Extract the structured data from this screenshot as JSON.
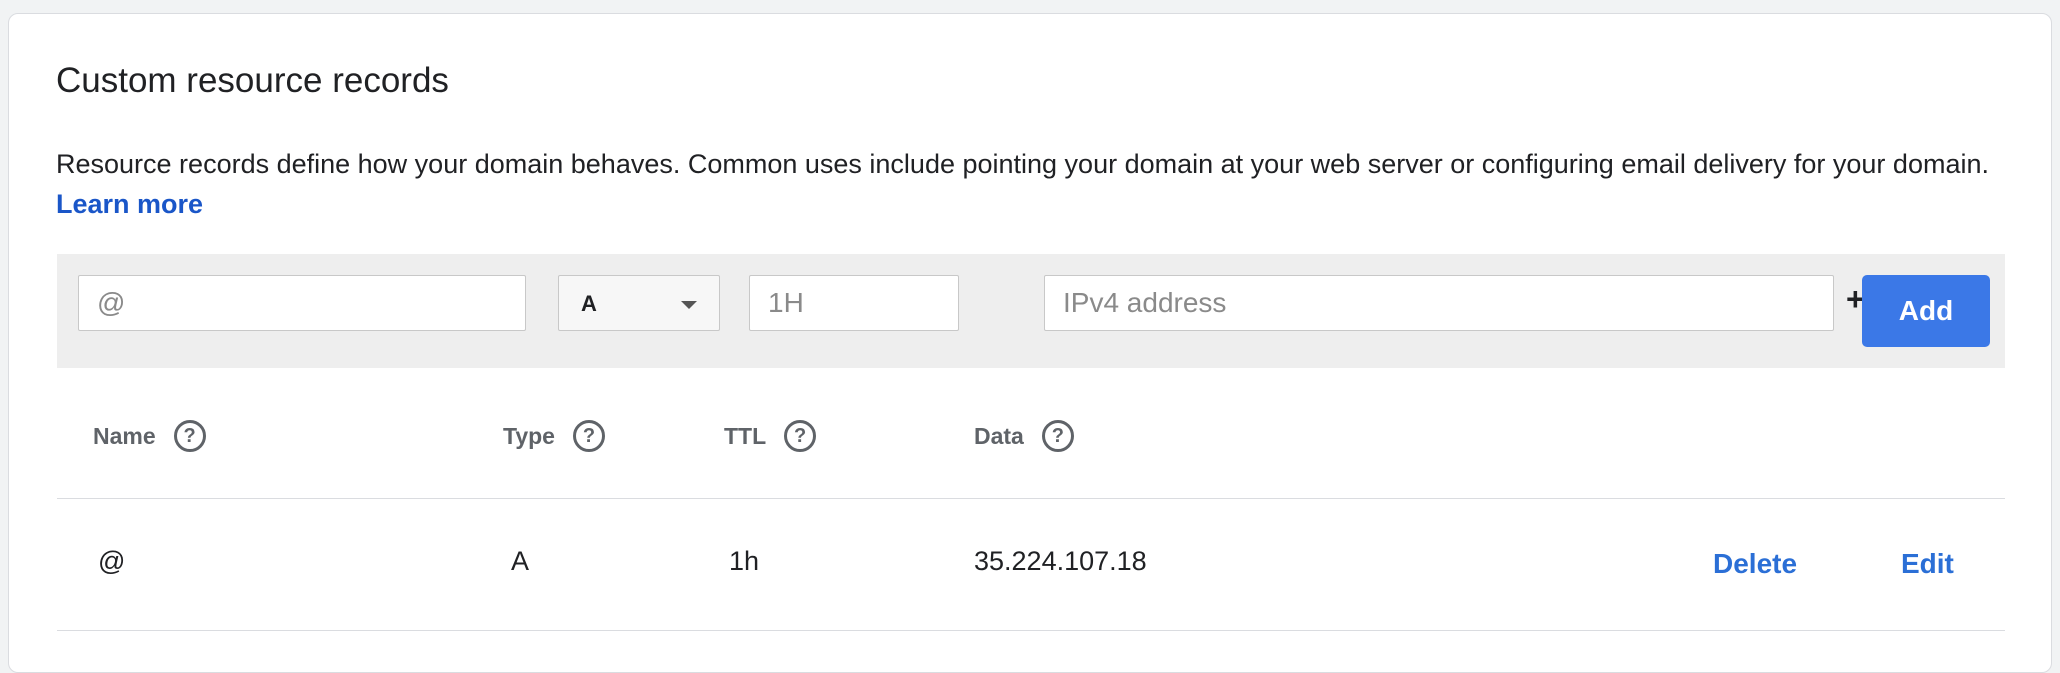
{
  "card": {
    "title": "Custom resource records",
    "description": "Resource records define how your domain behaves. Common uses include pointing your domain at your web server or configuring email delivery for your domain.",
    "learn_more": "Learn more"
  },
  "add_record": {
    "name_placeholder": "@",
    "type_value": "A",
    "ttl_placeholder": "1H",
    "data_placeholder": "IPv4 address",
    "plus_label": "+",
    "add_label": "Add"
  },
  "table": {
    "columns": [
      {
        "label": "Name",
        "help": "?"
      },
      {
        "label": "Type",
        "help": "?"
      },
      {
        "label": "TTL",
        "help": "?"
      },
      {
        "label": "Data",
        "help": "?"
      }
    ],
    "rows": [
      {
        "name": "@",
        "type": "A",
        "ttl": "1h",
        "data": "35.224.107.18",
        "delete_label": "Delete",
        "edit_label": "Edit"
      }
    ]
  },
  "colors": {
    "accent": "#3b78e7",
    "link": "#2b6fd6",
    "learn_more": "#1a56c8"
  },
  "icons": {
    "help": "help-circle-icon",
    "dropdown": "chevron-down-icon",
    "plus": "plus-icon"
  }
}
